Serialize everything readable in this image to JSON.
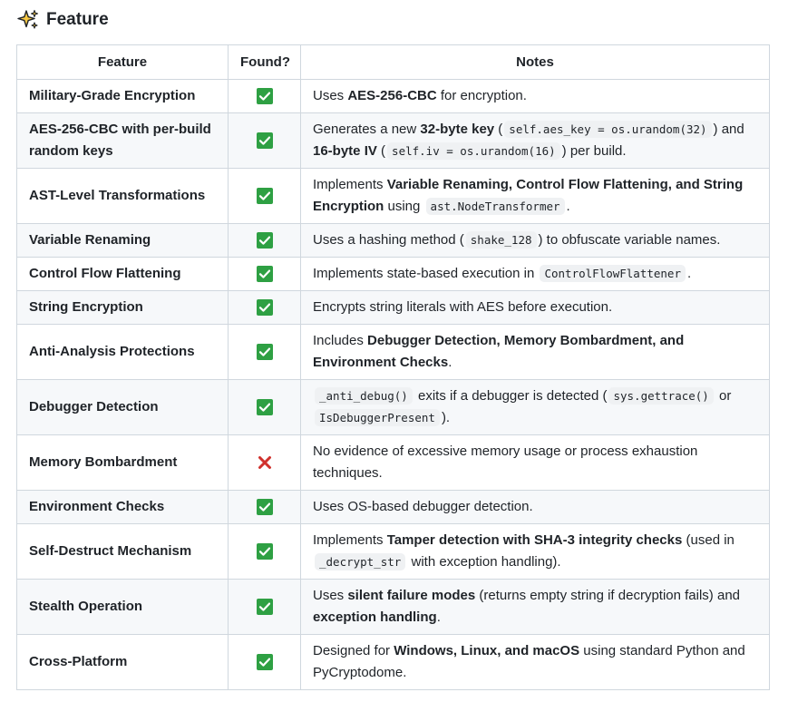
{
  "heading": {
    "icon": "sparkles-icon",
    "title": "Feature"
  },
  "table": {
    "headers": [
      "Feature",
      "Found?",
      "Notes"
    ],
    "rows": [
      {
        "feature": "Military-Grade Encryption",
        "found": "check",
        "notes": [
          {
            "t": "text",
            "v": "Uses "
          },
          {
            "t": "bold",
            "v": "AES-256-CBC"
          },
          {
            "t": "text",
            "v": " for encryption."
          }
        ]
      },
      {
        "feature": "AES-256-CBC with per-build random keys",
        "found": "check",
        "notes": [
          {
            "t": "text",
            "v": "Generates a new "
          },
          {
            "t": "bold",
            "v": "32-byte key"
          },
          {
            "t": "text",
            "v": " ("
          },
          {
            "t": "code",
            "v": "self.aes_key = os.urandom(32)"
          },
          {
            "t": "text",
            "v": ") and "
          },
          {
            "t": "bold",
            "v": "16-byte IV"
          },
          {
            "t": "text",
            "v": " ("
          },
          {
            "t": "code",
            "v": "self.iv = os.urandom(16)"
          },
          {
            "t": "text",
            "v": ") per build."
          }
        ]
      },
      {
        "feature": "AST-Level Transformations",
        "found": "check",
        "notes": [
          {
            "t": "text",
            "v": "Implements "
          },
          {
            "t": "bold",
            "v": "Variable Renaming, Control Flow Flattening, and String Encryption"
          },
          {
            "t": "text",
            "v": " using "
          },
          {
            "t": "code",
            "v": "ast.NodeTransformer"
          },
          {
            "t": "text",
            "v": "."
          }
        ]
      },
      {
        "feature": "Variable Renaming",
        "found": "check",
        "notes": [
          {
            "t": "text",
            "v": "Uses a hashing method ("
          },
          {
            "t": "code",
            "v": "shake_128"
          },
          {
            "t": "text",
            "v": ") to obfuscate variable names."
          }
        ]
      },
      {
        "feature": "Control Flow Flattening",
        "found": "check",
        "notes": [
          {
            "t": "text",
            "v": "Implements state-based execution in "
          },
          {
            "t": "code",
            "v": "ControlFlowFlattener"
          },
          {
            "t": "text",
            "v": "."
          }
        ]
      },
      {
        "feature": "String Encryption",
        "found": "check",
        "notes": [
          {
            "t": "text",
            "v": "Encrypts string literals with AES before execution."
          }
        ]
      },
      {
        "feature": "Anti-Analysis Protections",
        "found": "check",
        "notes": [
          {
            "t": "text",
            "v": "Includes "
          },
          {
            "t": "bold",
            "v": "Debugger Detection, Memory Bombardment, and Environment Checks"
          },
          {
            "t": "text",
            "v": "."
          }
        ]
      },
      {
        "feature": "Debugger Detection",
        "found": "check",
        "notes": [
          {
            "t": "code",
            "v": "_anti_debug()"
          },
          {
            "t": "text",
            "v": " exits if a debugger is detected ("
          },
          {
            "t": "code",
            "v": "sys.gettrace()"
          },
          {
            "t": "text",
            "v": " or "
          },
          {
            "t": "code",
            "v": "IsDebuggerPresent"
          },
          {
            "t": "text",
            "v": ")."
          }
        ]
      },
      {
        "feature": "Memory Bombardment",
        "found": "cross",
        "notes": [
          {
            "t": "text",
            "v": "No evidence of excessive memory usage or process exhaustion techniques."
          }
        ]
      },
      {
        "feature": "Environment Checks",
        "found": "check",
        "notes": [
          {
            "t": "text",
            "v": "Uses OS-based debugger detection."
          }
        ]
      },
      {
        "feature": "Self-Destruct Mechanism",
        "found": "check",
        "notes": [
          {
            "t": "text",
            "v": "Implements "
          },
          {
            "t": "bold",
            "v": "Tamper detection with SHA-3 integrity checks"
          },
          {
            "t": "text",
            "v": " (used in "
          },
          {
            "t": "code",
            "v": "_decrypt_str"
          },
          {
            "t": "text",
            "v": " with exception handling)."
          }
        ]
      },
      {
        "feature": "Stealth Operation",
        "found": "check",
        "notes": [
          {
            "t": "text",
            "v": "Uses "
          },
          {
            "t": "bold",
            "v": "silent failure modes"
          },
          {
            "t": "text",
            "v": " (returns empty string if decryption fails) and "
          },
          {
            "t": "bold",
            "v": "exception handling"
          },
          {
            "t": "text",
            "v": "."
          }
        ]
      },
      {
        "feature": "Cross-Platform",
        "found": "check",
        "notes": [
          {
            "t": "text",
            "v": "Designed for "
          },
          {
            "t": "bold",
            "v": "Windows, Linux, and macOS"
          },
          {
            "t": "text",
            "v": " using standard Python and PyCryptodome."
          }
        ]
      }
    ]
  }
}
